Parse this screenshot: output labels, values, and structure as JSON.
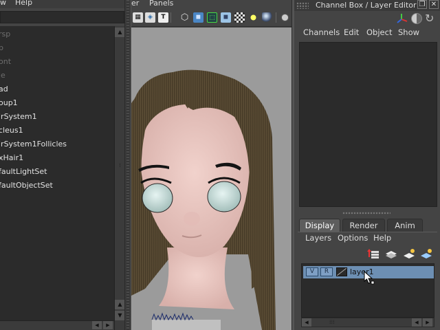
{
  "outliner": {
    "menu": {
      "view": "w",
      "help": "Help"
    },
    "items": [
      {
        "label": "rsp",
        "state": "dim"
      },
      {
        "label": "p",
        "state": "dim"
      },
      {
        "label": "ont",
        "state": "dim"
      },
      {
        "label": "le",
        "state": "dim"
      },
      {
        "label": "ad",
        "state": "lit"
      },
      {
        "label": "oup1",
        "state": "lit"
      },
      {
        "label": "irSystem1",
        "state": "lit"
      },
      {
        "label": "cleus1",
        "state": "lit"
      },
      {
        "label": "irSystem1Follicles",
        "state": "lit"
      },
      {
        "label": "xHair1",
        "state": "lit"
      },
      {
        "label": "faultLightSet",
        "state": "lit"
      },
      {
        "label": "faultObjectSet",
        "state": "lit"
      }
    ]
  },
  "viewport": {
    "menu": {
      "renderer": "er",
      "panels": "Panels"
    },
    "toolbar_icons": [
      "grid-icon",
      "texture-icon",
      "text-icon",
      "wireframe-icon",
      "smooth-shade-icon",
      "isolate-icon",
      "default-material-icon",
      "textured-icon",
      "lighting-icon",
      "shadow-icon",
      "camera-icon"
    ]
  },
  "channel_box": {
    "title": "Channel Box / Layer Editor",
    "menu": [
      "Channels",
      "Edit",
      "Object",
      "Show"
    ]
  },
  "layer_editor": {
    "tabs": [
      "Display",
      "Render",
      "Anim"
    ],
    "active_tab": "Display",
    "menu": [
      "Layers",
      "Options",
      "Help"
    ],
    "layers": [
      {
        "visible": "V",
        "reference": "R",
        "name": "layer1",
        "selected": true
      }
    ]
  },
  "colors": {
    "panel_bg": "#444444",
    "field_bg": "#2b2b2b",
    "selection": "#6d8fb3",
    "viewport_bg": "#9b9b9b"
  }
}
